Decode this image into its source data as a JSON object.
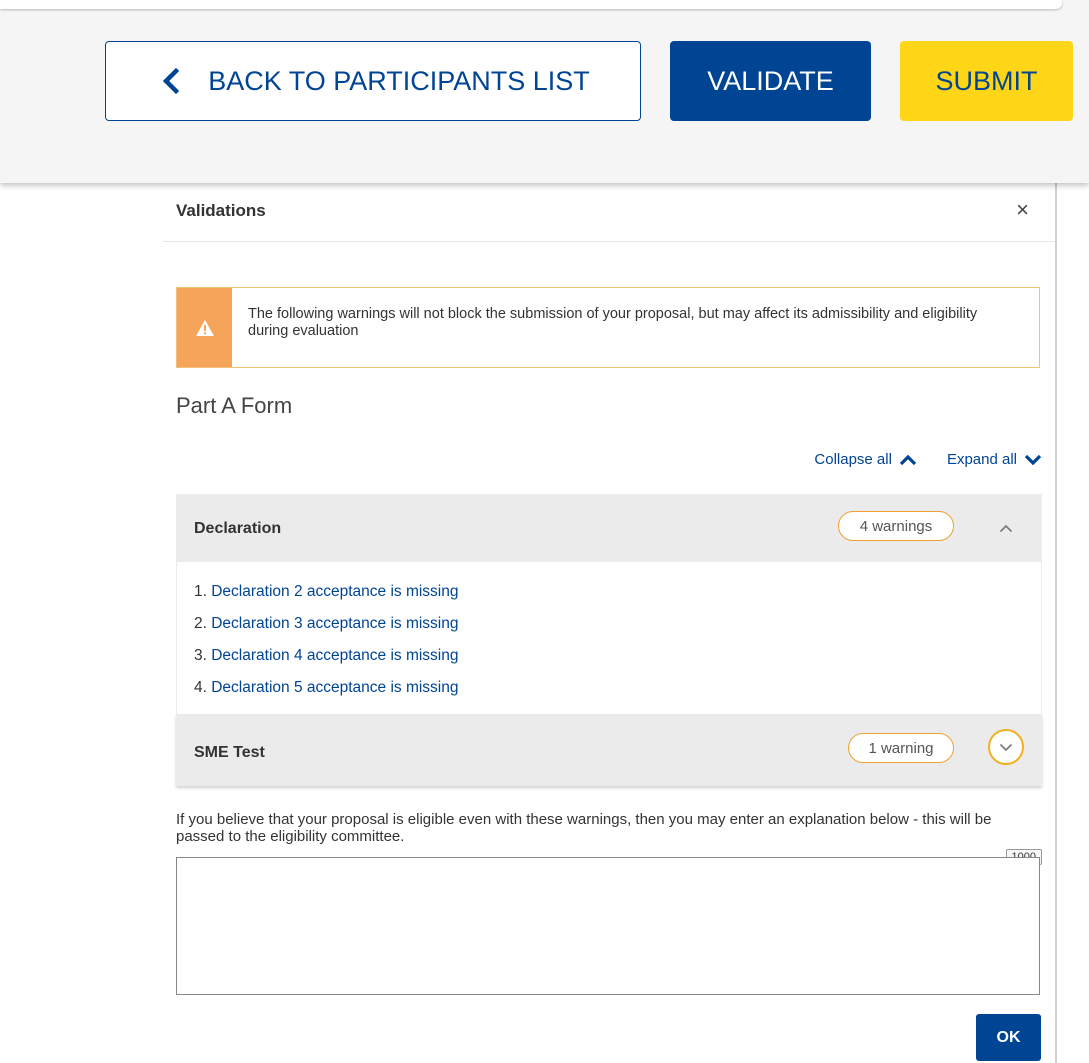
{
  "toolbar": {
    "back_label": "BACK TO PARTICIPANTS LIST",
    "validate_label": "VALIDATE",
    "submit_label": "SUBMIT"
  },
  "modal": {
    "title": "Validations",
    "close_symbol": "×",
    "alert_text": "The following warnings will not block the submission of your proposal, but may affect its admissibility and eligibility during evaluation",
    "section_title": "Part A Form",
    "collapse_all": "Collapse all",
    "expand_all": "Expand all",
    "groups": [
      {
        "title": "Declaration",
        "badge": "4 warnings",
        "expanded": true,
        "items": [
          {
            "num": "1. ",
            "text": "Declaration 2 acceptance is missing"
          },
          {
            "num": "2. ",
            "text": "Declaration 3 acceptance is missing"
          },
          {
            "num": "3. ",
            "text": "Declaration 4 acceptance is missing"
          },
          {
            "num": "4. ",
            "text": "Declaration 5 acceptance is missing"
          }
        ]
      },
      {
        "title": "SME Test",
        "badge": "1 warning",
        "expanded": false,
        "items": []
      }
    ],
    "explanation_text": "If you believe that your proposal is eligible even with these warnings, then you may enter an explanation below - this will be passed to the eligibility committee.",
    "char_counter": "1000",
    "explanation_value": "",
    "ok_label": "OK"
  },
  "colors": {
    "primary": "#004494",
    "accent_yellow": "#ffd617",
    "warning_orange": "#f6a45a",
    "badge_border": "#f0a030"
  },
  "icons": {
    "back": "chevron-left-icon",
    "close": "close-icon",
    "alert": "warning-triangle-icon",
    "collapse": "chevron-up-icon",
    "expand": "chevron-down-icon"
  }
}
